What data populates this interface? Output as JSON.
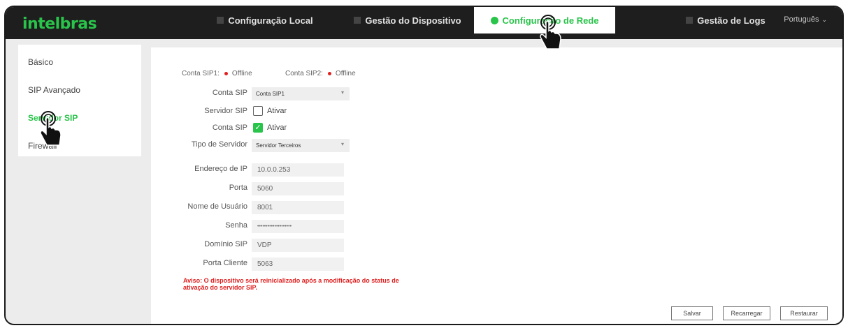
{
  "brand": {
    "logo_text": "intelbras",
    "accent_color": "#29c44a",
    "topbar_color": "#1e1e1e"
  },
  "nav": {
    "tabs": [
      {
        "label": "Configuração Local",
        "active": false
      },
      {
        "label": "Gestão do Dispositivo",
        "active": false
      },
      {
        "label": "Configuração de Rede",
        "active": true
      },
      {
        "label": "Gestão de Logs",
        "active": false
      }
    ],
    "language": "Português"
  },
  "sidebar": {
    "items": [
      {
        "label": "Básico",
        "active": false
      },
      {
        "label": "SIP Avançado",
        "active": false
      },
      {
        "label": "Servidor SIP",
        "active": true
      },
      {
        "label": "Firewall",
        "active": false
      }
    ]
  },
  "status": {
    "sip1_label": "Conta SIP1:",
    "sip1_value": "Offline",
    "sip2_label": "Conta SIP2:",
    "sip2_value": "Offline",
    "status_color": "#e02020"
  },
  "form": {
    "conta_sip": {
      "label": "Conta SIP",
      "value": "Conta SIP1"
    },
    "servidor_sip": {
      "label": "Servidor SIP",
      "option": "Ativar",
      "checked": false
    },
    "conta_sip_enable": {
      "label": "Conta SIP",
      "option": "Ativar",
      "checked": true
    },
    "tipo_servidor": {
      "label": "Tipo de Servidor",
      "value": "Servidor Terceiros"
    },
    "endereco_ip": {
      "label": "Endereço de IP",
      "value": "10.0.0.253"
    },
    "porta": {
      "label": "Porta",
      "value": "5060"
    },
    "usuario": {
      "label": "Nome de Usuário",
      "value": "8001"
    },
    "senha": {
      "label": "Senha",
      "value": "••••••••••••••••••••"
    },
    "dominio": {
      "label": "Domínio SIP",
      "value": "VDP"
    },
    "porta_cliente": {
      "label": "Porta Cliente",
      "value": "5063"
    }
  },
  "warning": "Aviso: O dispositivo será reinicializado após a modificação do status de ativação do servidor SIP.",
  "buttons": {
    "save": "Salvar",
    "reload": "Recarregar",
    "restore": "Restaurar"
  }
}
